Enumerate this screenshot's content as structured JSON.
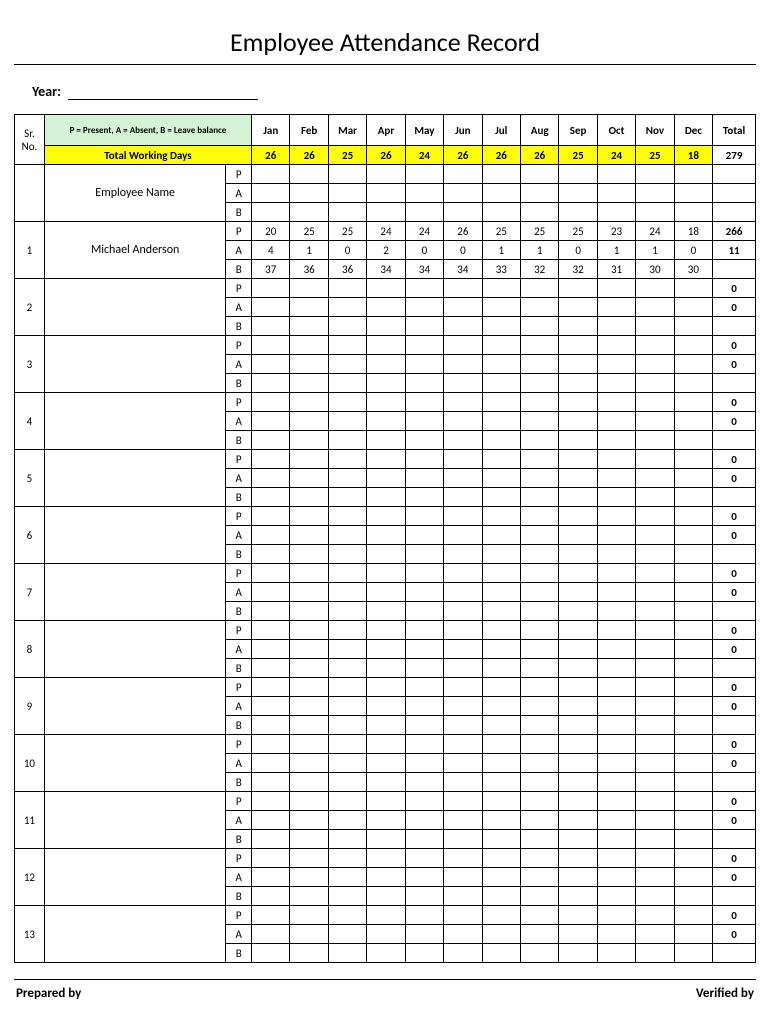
{
  "title": "Employee Attendance Record",
  "year_label": "Year:",
  "legend": "P = Present, A = Absent, B = Leave balance",
  "sr_label": "Sr. No.",
  "months": [
    "Jan",
    "Feb",
    "Mar",
    "Apr",
    "May",
    "Jun",
    "Jul",
    "Aug",
    "Sep",
    "Oct",
    "Nov",
    "Dec"
  ],
  "total_label": "Total",
  "twd_label": "Total Working Days",
  "twd_values": [
    "26",
    "26",
    "25",
    "26",
    "24",
    "26",
    "26",
    "26",
    "25",
    "24",
    "25",
    "18"
  ],
  "twd_total": "279",
  "name_header": "Employee Name",
  "pab_labels": [
    "P",
    "A",
    "B"
  ],
  "employees": [
    {
      "sr": "1",
      "name": "Michael Anderson",
      "P": [
        "20",
        "25",
        "25",
        "24",
        "24",
        "26",
        "25",
        "25",
        "25",
        "23",
        "24",
        "18"
      ],
      "P_total": "266",
      "A": [
        "4",
        "1",
        "0",
        "2",
        "0",
        "0",
        "1",
        "1",
        "0",
        "1",
        "1",
        "0"
      ],
      "A_total": "11",
      "B": [
        "37",
        "36",
        "36",
        "34",
        "34",
        "34",
        "33",
        "32",
        "32",
        "31",
        "30",
        "30"
      ],
      "B_total": ""
    },
    {
      "sr": "2",
      "name": "",
      "P_total": "0",
      "A_total": "0"
    },
    {
      "sr": "3",
      "name": "",
      "P_total": "0",
      "A_total": "0"
    },
    {
      "sr": "4",
      "name": "",
      "P_total": "0",
      "A_total": "0"
    },
    {
      "sr": "5",
      "name": "",
      "P_total": "0",
      "A_total": "0"
    },
    {
      "sr": "6",
      "name": "",
      "P_total": "0",
      "A_total": "0"
    },
    {
      "sr": "7",
      "name": "",
      "P_total": "0",
      "A_total": "0"
    },
    {
      "sr": "8",
      "name": "",
      "P_total": "0",
      "A_total": "0"
    },
    {
      "sr": "9",
      "name": "",
      "P_total": "0",
      "A_total": "0"
    },
    {
      "sr": "10",
      "name": "",
      "P_total": "0",
      "A_total": "0"
    },
    {
      "sr": "11",
      "name": "",
      "P_total": "0",
      "A_total": "0"
    },
    {
      "sr": "12",
      "name": "",
      "P_total": "0",
      "A_total": "0"
    },
    {
      "sr": "13",
      "name": "",
      "P_total": "0",
      "A_total": "0"
    }
  ],
  "footer": {
    "prepared": "Prepared by",
    "verified": "Verified by"
  }
}
